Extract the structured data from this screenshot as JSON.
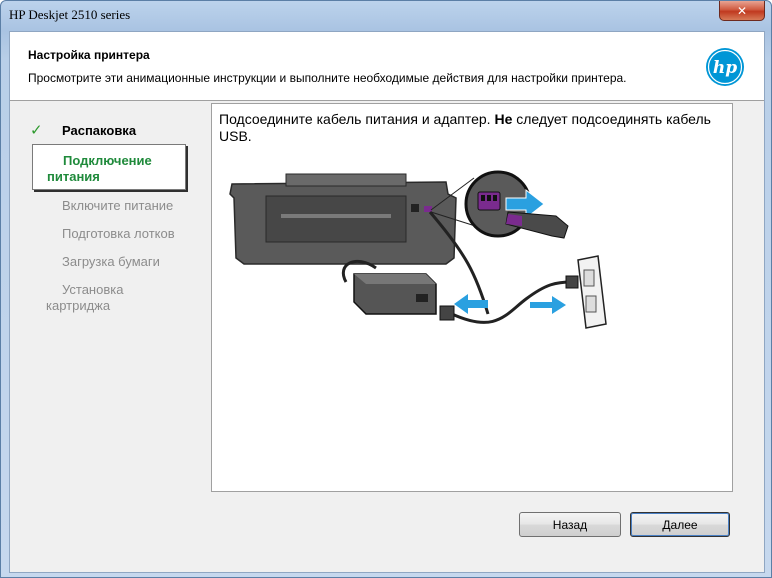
{
  "window": {
    "title": "HP Deskjet 2510 series",
    "close_symbol": "✕"
  },
  "header": {
    "title": "Настройка принтера",
    "subtitle": "Просмотрите эти анимационные инструкции и выполните необходимые действия для настройки принтера.",
    "logo_text": "hp"
  },
  "steps": [
    {
      "label": "Распаковка",
      "state": "done",
      "check": "✓"
    },
    {
      "label": "Подключение питания",
      "state": "current"
    },
    {
      "label": "Включите питание",
      "state": "pending"
    },
    {
      "label": "Подготовка лотков",
      "state": "pending"
    },
    {
      "label": "Загрузка бумаги",
      "state": "pending"
    },
    {
      "label": "Установка картриджа",
      "state": "pending"
    }
  ],
  "content": {
    "instruction_part1": "Подсоедините кабель питания и адаптер. ",
    "instruction_bold": "Не",
    "instruction_part2": " следует подсоединять кабель USB."
  },
  "buttons": {
    "back": "Назад",
    "next": "Далее"
  },
  "colors": {
    "accent_green": "#1f8a3b",
    "hp_blue": "#0096d6",
    "arrow_blue": "#2aa0e0",
    "port_purple": "#7a2b8e"
  }
}
